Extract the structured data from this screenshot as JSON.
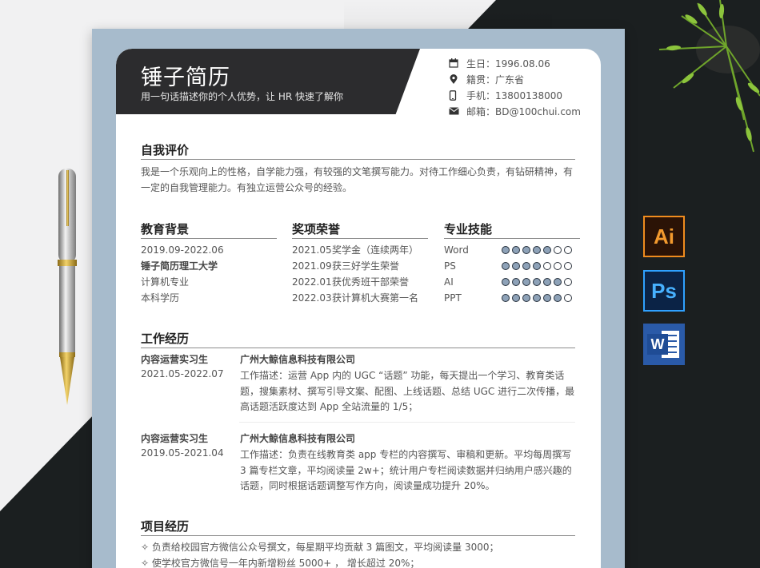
{
  "resume": {
    "name": "锤子简历",
    "tagline": "用一句话描述你的个人优势，让 HR 快速了解你",
    "contact": [
      {
        "icon": "calendar-icon",
        "text": "生日：1996.08.06"
      },
      {
        "icon": "location-pin-icon",
        "text": "籍贯：广东省"
      },
      {
        "icon": "phone-icon",
        "text": "手机：13800138000"
      },
      {
        "icon": "mail-icon",
        "text": "邮箱：BD@100chui.com"
      }
    ],
    "self_eval": {
      "title": "自我评价",
      "text": "我是一个乐观向上的性格，自学能力强，有较强的文笔撰写能力。对待工作细心负责，有钻研精神，有一定的自我管理能力。有独立运营公众号的经验。"
    },
    "education": {
      "title": "教育背景",
      "lines": [
        "2019.09-2022.06",
        "锤子简历理工大学",
        "计算机专业",
        "本科学历"
      ]
    },
    "awards": {
      "title": "奖项荣誉",
      "items": [
        {
          "date": "2021.05",
          "text": "奖学金（连续两年）"
        },
        {
          "date": "2021.09",
          "text": "获三好学生荣誉"
        },
        {
          "date": "2022.01",
          "text": "获优秀班干部荣誉"
        },
        {
          "date": "2022.03",
          "text": "获计算机大赛第一名"
        }
      ]
    },
    "skills": {
      "title": "专业技能",
      "items": [
        {
          "name": "Word",
          "level": 5,
          "max": 7
        },
        {
          "name": "PS",
          "level": 4,
          "max": 7
        },
        {
          "name": "AI",
          "level": 6,
          "max": 7
        },
        {
          "name": "PPT",
          "level": 6,
          "max": 7
        }
      ]
    },
    "work": {
      "title": "工作经历",
      "jobs": [
        {
          "role": "内容运营实习生",
          "period": "2021.05-2022.07",
          "company": "广州大鲸信息科技有限公司",
          "desc": "工作描述：运营 App 内的 UGC “话题” 功能，每天提出一个学习、教育类话题，搜集素材、撰写引导文案、配图、上线话题、总结 UGC 进行二次传播，最高话题活跃度达到 App 全站流量的 1/5；"
        },
        {
          "role": "内容运营实习生",
          "period": "2019.05-2021.04",
          "company": "广州大鲸信息科技有限公司",
          "desc": "工作描述：负责在线教育类 app 专栏的内容撰写、审稿和更新。平均每周撰写 3 篇专栏文章，平均阅读量 2w+；统计用户专栏阅读数据并归纳用户感兴趣的话题，同时根据话题调整写作方向，阅读量成功提升 20%。"
        }
      ]
    },
    "projects": {
      "title": "项目经历",
      "items": [
        "✧  负责给校园官方微信公众号撰文，每星期平均贡献 3 篇图文，平均阅读量 3000；",
        "✧  使学校官方微信号一年内新增粉丝 5000+ ，  增长超过 20%；"
      ]
    }
  },
  "apps": {
    "ai": "Ai",
    "ps": "Ps",
    "word": "W"
  },
  "colors": {
    "banner": "#2c2c2e",
    "frame": "#a7bbcc",
    "skill_dot": "#8ea2b8",
    "ai_orange": "#f08c1e",
    "ps_blue": "#2fa1ff",
    "word_blue": "#2a5aa8"
  }
}
